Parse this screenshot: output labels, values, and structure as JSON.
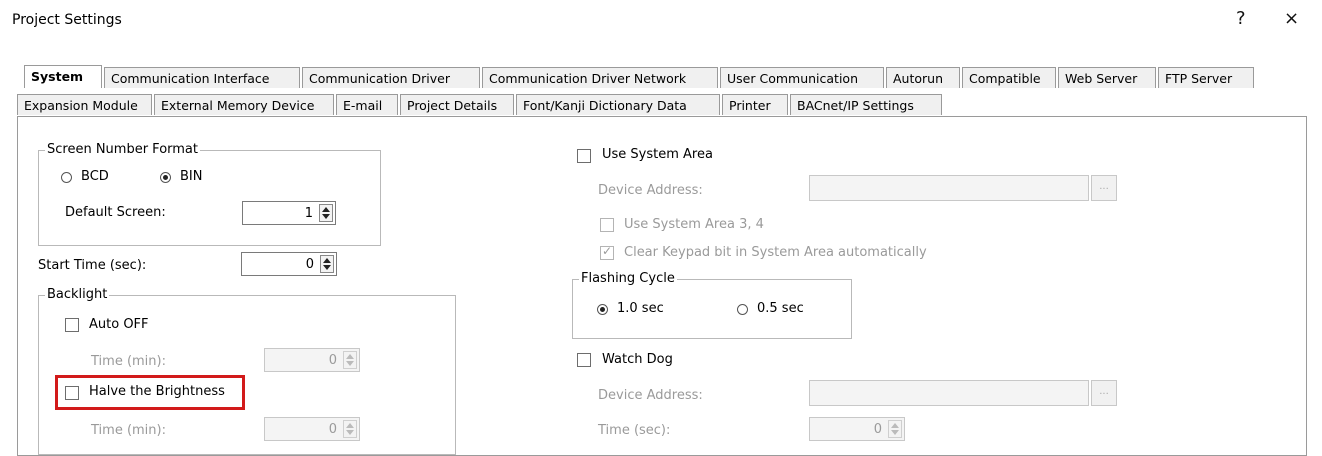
{
  "window": {
    "title": "Project Settings",
    "help_glyph": "?",
    "close_glyph": "×"
  },
  "tabs": {
    "row1": [
      "System",
      "Communication Interface",
      "Communication Driver",
      "Communication Driver Network",
      "User Communication",
      "Autorun",
      "Compatible",
      "Web Server",
      "FTP Server"
    ],
    "row2": [
      "Expansion Module",
      "External Memory Device",
      "E-mail",
      "Project Details",
      "Font/Kanji Dictionary Data",
      "Printer",
      "BACnet/IP Settings"
    ],
    "active": "System"
  },
  "screen_number_format": {
    "label": "Screen Number Format",
    "option_bcd": "BCD",
    "option_bin": "BIN",
    "selected": "BIN",
    "default_screen_label": "Default Screen:",
    "default_screen_value": "1"
  },
  "start_time": {
    "label": "Start Time (sec):",
    "value": "0"
  },
  "backlight": {
    "label": "Backlight",
    "auto_off_label": "Auto OFF",
    "time1_label": "Time (min):",
    "time1_value": "0",
    "halve_label": "Halve the Brightness",
    "time2_label": "Time (min):",
    "time2_value": "0"
  },
  "system_area": {
    "use_label": "Use System Area",
    "device_address_label": "Device Address:",
    "use_area34_label": "Use System Area 3, 4",
    "clear_keypad_label": "Clear Keypad bit in System Area automatically",
    "browse_glyph": "..."
  },
  "flashing_cycle": {
    "label": "Flashing Cycle",
    "option1": "1.0 sec",
    "option2": "0.5 sec",
    "selected": "1.0 sec"
  },
  "watch_dog": {
    "label": "Watch Dog",
    "device_address_label": "Device Address:",
    "time_label": "Time (sec):",
    "time_value": "0",
    "browse_glyph": "..."
  },
  "colors": {
    "highlight": "#d21a1a"
  }
}
